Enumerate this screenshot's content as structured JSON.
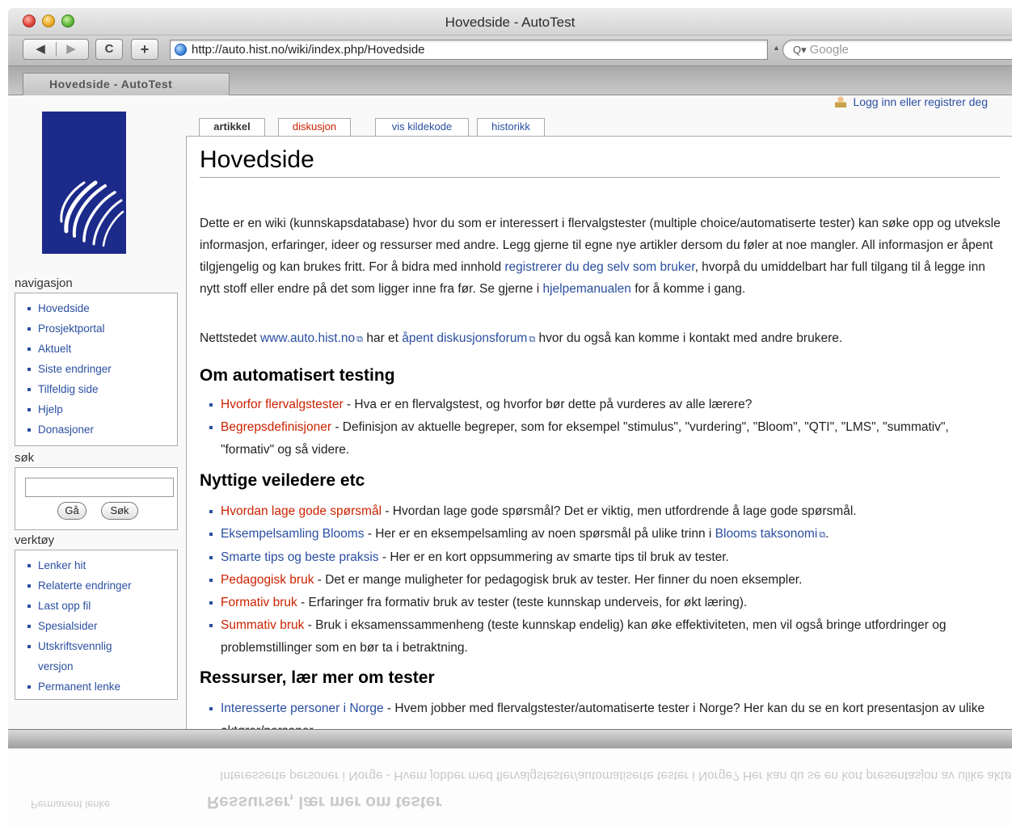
{
  "window": {
    "title": "Hovedside - AutoTest",
    "url": "http://auto.hist.no/wiki/index.php/Hovedside",
    "search_placeholder": "Google",
    "tab_label": "Hovedside - AutoTest",
    "reload_glyph": "C",
    "add_glyph": "+",
    "back_glyph": "◀",
    "forward_glyph": "▶"
  },
  "user_link": "Logg inn eller registrer deg",
  "page_tabs": {
    "article": "artikkel",
    "discussion": "diskusjon",
    "view_source": "vis kildekode",
    "history": "historikk"
  },
  "sidebar": {
    "nav_heading": "navigasjon",
    "nav_items": [
      "Hovedside",
      "Prosjektportal",
      "Aktuelt",
      "Siste endringer",
      "Tilfeldig side",
      "Hjelp",
      "Donasjoner"
    ],
    "search_heading": "søk",
    "go_button": "Gå",
    "search_button": "Søk",
    "tools_heading": "verktøy",
    "tools_items": [
      "Lenker hit",
      "Relaterte endringer",
      "Last opp fil",
      "Spesialsider",
      "Utskriftsvennlig versjon",
      "Permanent lenke"
    ]
  },
  "content": {
    "title": "Hovedside",
    "intro": {
      "part1": "Dette er en wiki (kunnskapsdatabase) hvor du som er interessert i flervalgstester (multiple choice/automatiserte tester) kan søke opp og utveksle informasjon, erfaringer, ideer og ressurser med andre. Legg gjerne til egne nye artikler dersom du føler at noe mangler. All informasjon er åpent tilgjengelig og kan brukes fritt. For å bidra med innhold ",
      "link1": "registrerer du deg selv som bruker",
      "part2": ", hvorpå du umiddelbart har full tilgang til å legge inn nytt stoff eller endre på det som ligger inne fra før. Se gjerne i ",
      "link2": "hjelpemanualen",
      "part3": " for å komme i gang."
    },
    "site_line": {
      "part1": "Nettstedet ",
      "link1": "www.auto.hist.no",
      "part2": " har et ",
      "link2": "åpent diskusjonsforum",
      "part3": " hvor du også kan komme i kontakt med andre brukere."
    },
    "section1": {
      "heading": "Om automatisert testing",
      "items": [
        {
          "link": "Hvorfor flervalgstester",
          "text": " - Hva er en flervalgstest, og hvorfor bør dette på vurderes av alle lærere?"
        },
        {
          "link": "Begrepsdefinisjoner",
          "text": " - Definisjon av aktuelle begreper, som for eksempel \"stimulus\", \"vurdering\", \"Bloom\", \"QTI\", \"LMS\", \"summativ\", \"formativ\" og så videre."
        }
      ]
    },
    "section2": {
      "heading": "Nyttige veiledere etc",
      "items": [
        {
          "link": "Hvordan lage gode spørsmål",
          "text": " - Hvordan lage gode spørsmål? Det er viktig, men utfordrende å lage gode spørsmål."
        },
        {
          "link": "Eksempelsamling Blooms",
          "text": " - Her er en eksempelsamling av noen spørsmål på ulike trinn i ",
          "link2": "Blooms taksonomi",
          "text2": "."
        },
        {
          "link": "Smarte tips og beste praksis",
          "text": " - Her er en kort oppsummering av smarte tips til bruk av tester."
        },
        {
          "link": "Pedagogisk bruk",
          "text": " - Det er mange muligheter for pedagogisk bruk av tester. Her finner du noen eksempler."
        },
        {
          "link": "Formativ bruk",
          "text": " - Erfaringer fra formativ bruk av tester (teste kunnskap underveis, for økt læring)."
        },
        {
          "link": "Summativ bruk",
          "text": " - Bruk i eksamenssammenheng (teste kunnskap endelig) kan øke effektiviteten, men vil også bringe utfordringer og problemstillinger som en bør ta i betraktning."
        }
      ]
    },
    "section3": {
      "heading": "Ressurser, lær mer om tester",
      "items": [
        {
          "link": "Interesserte personer i Norge",
          "text": " - Hvem jobber med flervalgstester/automatiserte tester i Norge? Her kan du se en kort presentasjon av ulike aktører/personer."
        }
      ]
    }
  },
  "colors": {
    "link": "#2a4fa0",
    "missing_link": "#cc2200",
    "logo_bg": "#1c2a8a"
  }
}
